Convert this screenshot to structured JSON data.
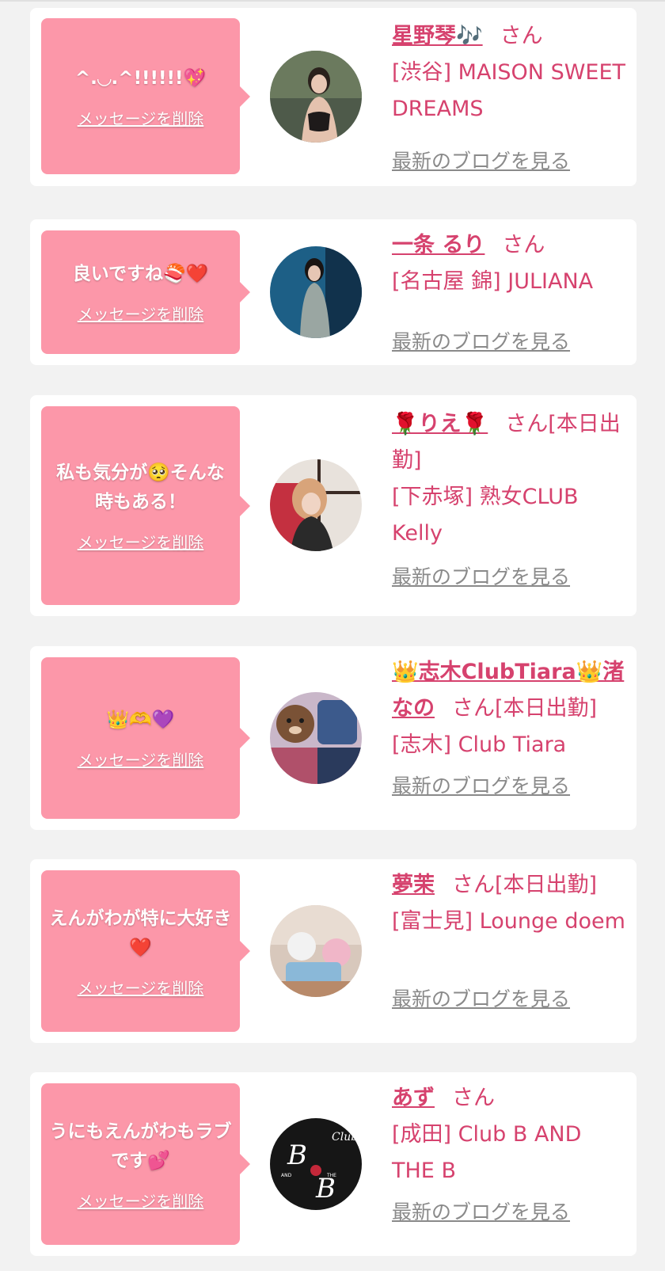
{
  "colors": {
    "background": "#f2f2f2",
    "card": "#ffffff",
    "bubble": "#fc97a9",
    "accent_text": "#d6426e",
    "blog_link": "#8a8a8a"
  },
  "delete_label": "メッセージを削除",
  "blog_label": "最新のブログを見る",
  "items": [
    {
      "message": "^.◡.^!!!!!!💖",
      "name": "星野琴🎶",
      "suffix": "さん",
      "shop_area": "[渋谷]",
      "shop_name": "MAISON SWEET DREAMS",
      "avatar": "avatar-photo"
    },
    {
      "message": "良いですね🍣❤️",
      "name": "一条 るり",
      "suffix": "さん",
      "shop_area": "[名古屋 錦]",
      "shop_name": "JULIANA",
      "avatar": "avatar-photo"
    },
    {
      "message": "私も気分が🥺そんな時もある！",
      "name": "🌹りえ🌹",
      "suffix": "さん[本日出勤]",
      "shop_area": "[下赤塚]",
      "shop_name": "熟女CLUB Kelly",
      "avatar": "avatar-photo"
    },
    {
      "message": "👑🫶💜",
      "name": "👑志木ClubTiara👑渚なの",
      "suffix": "さん[本日出勤]",
      "shop_area": "[志木]",
      "shop_name": "Club Tiara",
      "avatar": "avatar-photo"
    },
    {
      "message": "えんがわが特に大好き❤️",
      "name": "夢茉",
      "suffix": "さん[本日出勤]",
      "shop_area": "[富士見]",
      "shop_name": "Lounge doem",
      "avatar": "avatar-photo"
    },
    {
      "message": "うにもえんがわもラブです💕",
      "name": "あず",
      "suffix": "さん",
      "shop_area": "[成田]",
      "shop_name": "Club B AND THE B",
      "avatar": "avatar-logo",
      "logo_text": "Club",
      "logo_mark": "B AND THE B"
    }
  ]
}
